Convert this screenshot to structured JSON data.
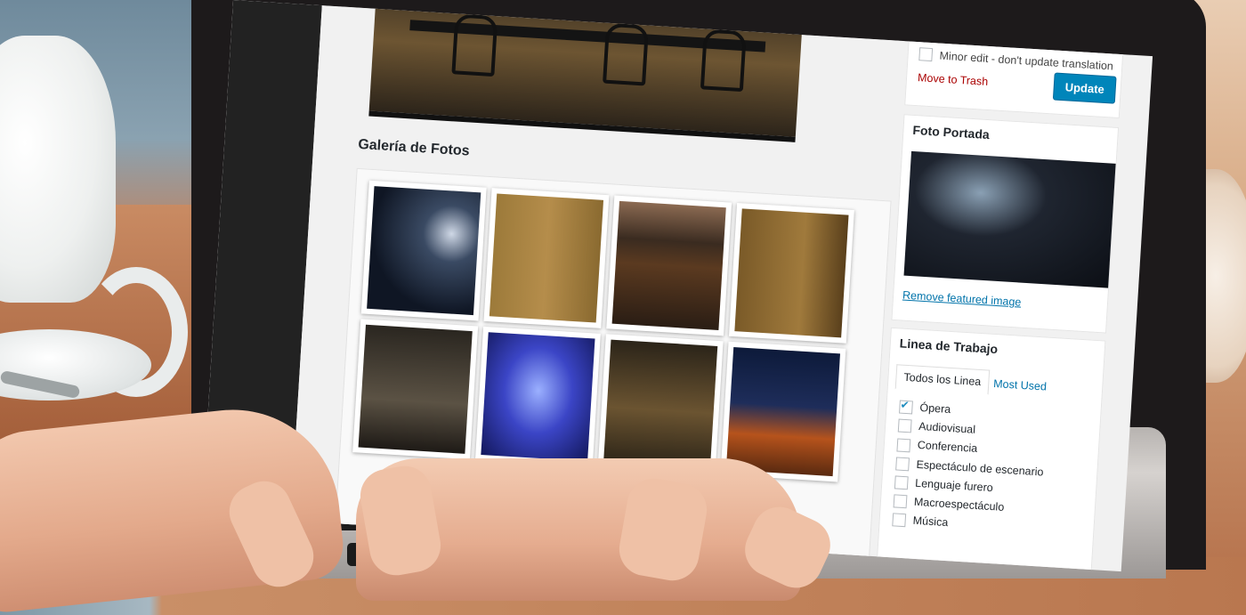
{
  "publish_box": {
    "minor_edit_label": "Minor edit - don't update translation",
    "move_to_trash": "Move to Trash",
    "update_button": "Update"
  },
  "gallery": {
    "title": "Galería de Fotos",
    "thumbnails": [
      "photo-1",
      "photo-2",
      "photo-3",
      "photo-4",
      "photo-5",
      "photo-6",
      "photo-7",
      "photo-8"
    ]
  },
  "featured_image": {
    "title": "Foto Portada",
    "remove_link": "Remove featured image"
  },
  "categories": {
    "title": "Linea de Trabajo",
    "tabs": [
      {
        "label": "Todos los Linea",
        "active": true
      },
      {
        "label": "Most Used",
        "active": false
      }
    ],
    "items": [
      {
        "label": "Ópera",
        "checked": true
      },
      {
        "label": "Audiovisual",
        "checked": false
      },
      {
        "label": "Conferencia",
        "checked": false
      },
      {
        "label": "Espectáculo de escenario",
        "checked": false
      },
      {
        "label": "Lenguaje furero",
        "checked": false
      },
      {
        "label": "Macroespectáculo",
        "checked": false
      },
      {
        "label": "Música",
        "checked": false
      }
    ]
  },
  "colors": {
    "wp_blue": "#0085ba",
    "trash_red": "#aa0000",
    "admin_sidebar": "#222222"
  }
}
